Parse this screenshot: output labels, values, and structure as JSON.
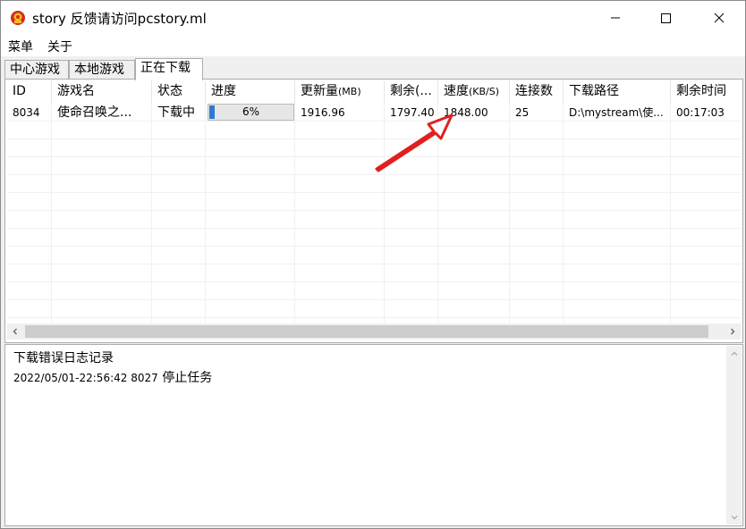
{
  "window": {
    "title": "story 反馈请访问pcstory.ml"
  },
  "menu": {
    "main_label": "菜单",
    "about_label": "关于"
  },
  "tabs": [
    {
      "label": "中心游戏"
    },
    {
      "label": "本地游戏"
    },
    {
      "label": "正在下载"
    }
  ],
  "table": {
    "columns": [
      {
        "label": "ID"
      },
      {
        "label": "游戏名"
      },
      {
        "label": "状态"
      },
      {
        "label": "进度"
      },
      {
        "label": "更新量",
        "unit": "(MB)"
      },
      {
        "label": "剩余(...",
        "unit": ""
      },
      {
        "label": "速度",
        "unit": "(KB/S)"
      },
      {
        "label": "连接数"
      },
      {
        "label": "下载路径"
      },
      {
        "label": "剩余时间"
      }
    ],
    "rows": [
      {
        "id": "8034",
        "name": "使命召唤之...",
        "status": "下载中",
        "progress_text": "6%",
        "progress_fraction": 0.06,
        "update_size": "1916.96",
        "remaining": "1797.40",
        "speed": "1848.00",
        "connections": "25",
        "path": "D:\\mystream\\使...",
        "time_left": "00:17:03"
      }
    ]
  },
  "log": {
    "title": "下载错误日志记录",
    "entries": [
      {
        "timestamp": "2022/05/01-22:56:42 8027",
        "message": "停止任务"
      }
    ]
  },
  "colors": {
    "progress_fill": "#2b7bd4",
    "annotation_arrow": "#e02020"
  }
}
